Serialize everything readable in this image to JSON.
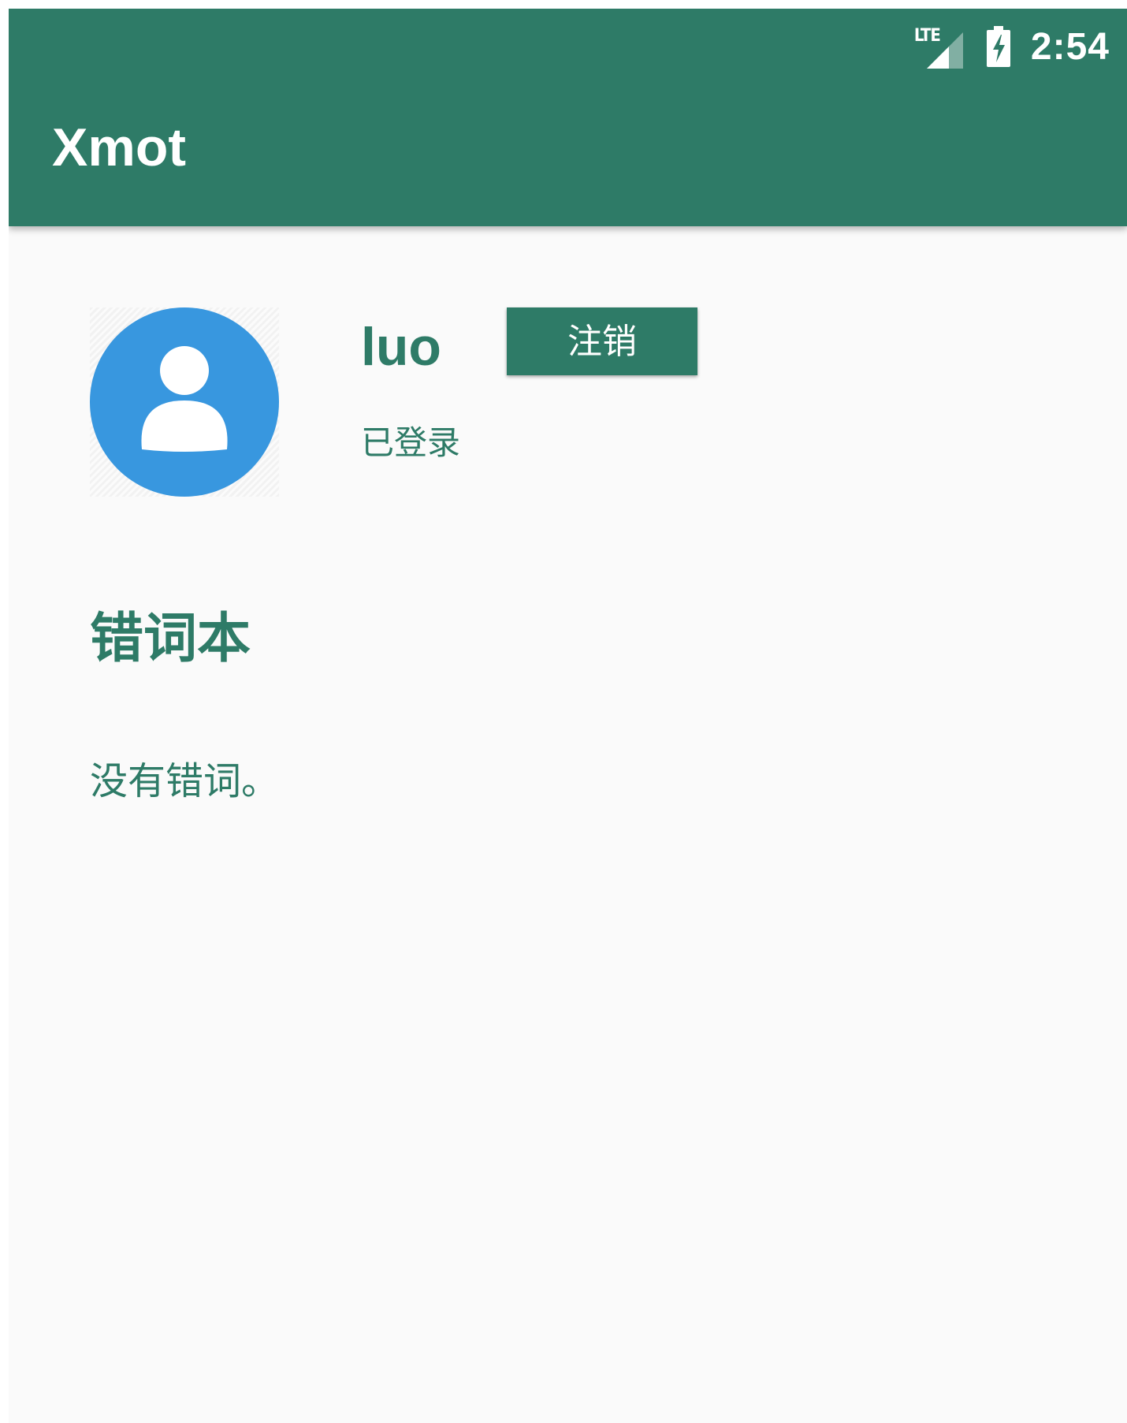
{
  "status_bar": {
    "network_label": "LTE",
    "network_icon": "lte-signal-icon",
    "battery_icon": "battery-charging-icon",
    "time": "2:54"
  },
  "app_bar": {
    "title": "Xmot"
  },
  "profile": {
    "avatar_icon": "default-user-avatar-icon",
    "username": "luo",
    "logout_label": "注销",
    "status": "已登录"
  },
  "wrong_words": {
    "title": "错词本",
    "empty_message": "没有错词。"
  },
  "colors": {
    "primary": "#2e7b67",
    "avatar_blue": "#3897df",
    "background": "#fafafa",
    "text_on_primary": "#ffffff"
  }
}
